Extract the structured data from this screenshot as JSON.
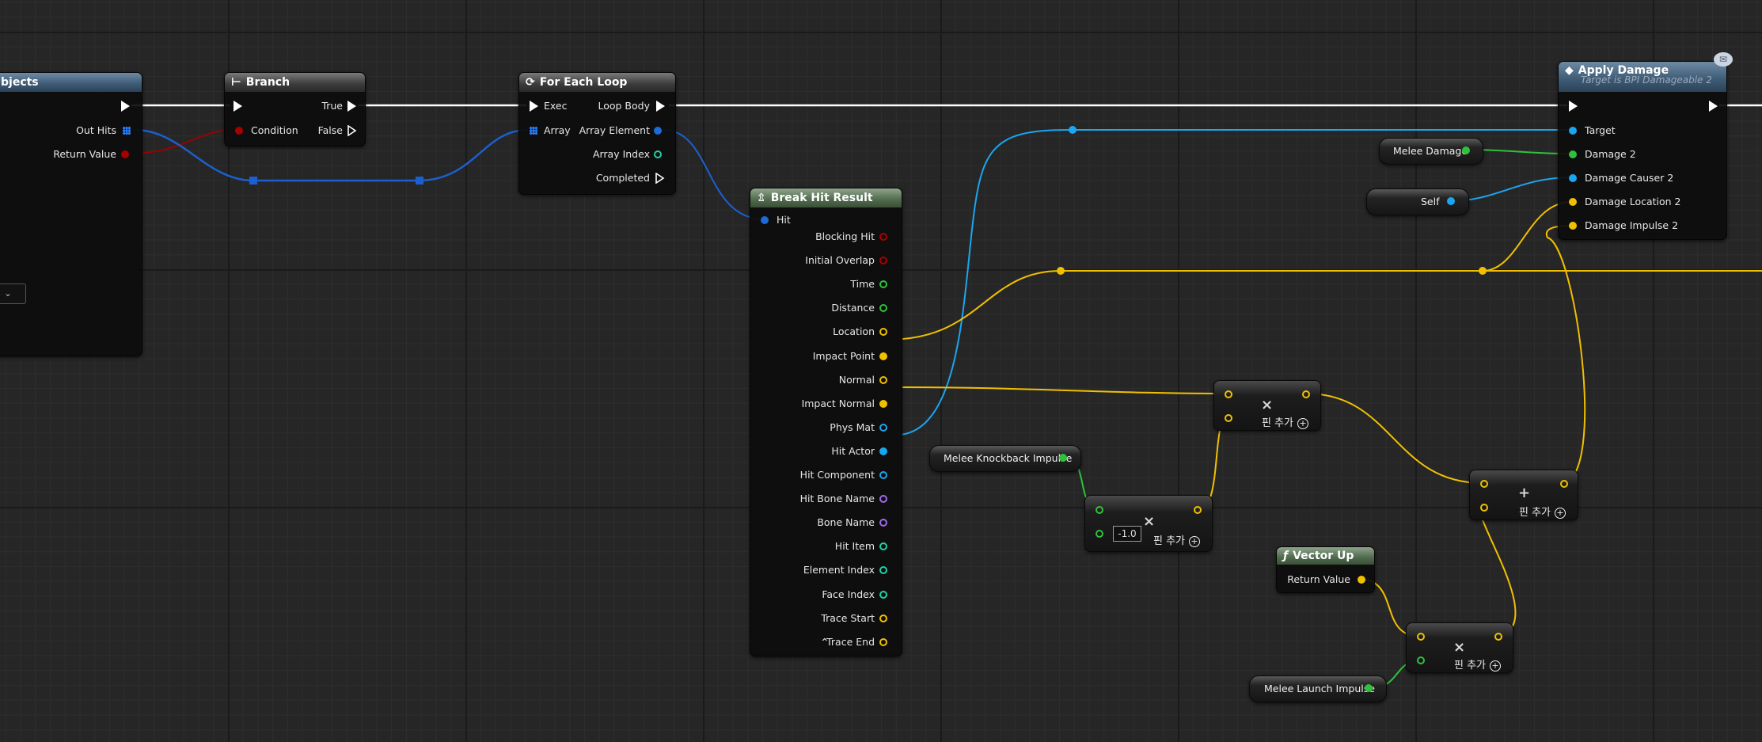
{
  "colors": {
    "exec": "#ffffff",
    "struct_blue": "#1c6bd6",
    "object_cyan": "#1aa6f0",
    "vector_yellow": "#f0c000",
    "float_green": "#2ec23a",
    "bool_red": "#a80000",
    "int_teal": "#1fd1a8",
    "name_purple": "#a06ae8",
    "background": "#262626"
  },
  "nodes": {
    "trace": {
      "title": "bjects",
      "pins": [
        "Out Hits",
        "Return Value"
      ],
      "dropdown_icon": "chevron-down-icon"
    },
    "branch": {
      "title": "Branch",
      "icon": "branch-icon",
      "inputs": [
        "Condition"
      ],
      "outputs": [
        "True",
        "False"
      ]
    },
    "foreach": {
      "title": "For Each Loop",
      "icon": "loop-icon",
      "inputs": [
        "Exec",
        "Array"
      ],
      "outputs": [
        "Loop Body",
        "Array Element",
        "Array Index",
        "Completed"
      ]
    },
    "breakhit": {
      "title": "Break Hit Result",
      "icon": "break-struct-icon",
      "input": "Hit",
      "outputs": [
        "Blocking Hit",
        "Initial Overlap",
        "Time",
        "Distance",
        "Location",
        "Impact Point",
        "Normal",
        "Impact Normal",
        "Phys Mat",
        "Hit Actor",
        "Hit Component",
        "Hit Bone Name",
        "Bone Name",
        "Hit Item",
        "Element Index",
        "Face Index",
        "Trace Start",
        "Trace End"
      ],
      "collapse_icon": "chevron-up-icon"
    },
    "apply": {
      "title": "Apply Damage",
      "subtitle": "Target is BPI Damageable 2",
      "icon": "interface-message-icon",
      "inputs": [
        "Target",
        "Damage 2",
        "Damage Causer 2",
        "Damage Location 2",
        "Damage Impulse 2"
      ]
    },
    "melee_damage": {
      "label": "Melee Damage"
    },
    "self": {
      "label": "Self"
    },
    "knockback": {
      "label": "Melee Knockback Impulse"
    },
    "launch": {
      "label": "Melee Launch Impulse"
    },
    "vector_up": {
      "title": "Vector Up",
      "icon": "function-icon",
      "output": "Return Value"
    },
    "mul1": {
      "symbol": "×",
      "add_pin": "핀 추가"
    },
    "mul2": {
      "symbol": "×",
      "add_pin": "핀 추가",
      "value": "-1.0"
    },
    "add1": {
      "symbol": "+",
      "add_pin": "핀 추가"
    },
    "mul3": {
      "symbol": "×",
      "add_pin": "핀 추가"
    }
  }
}
